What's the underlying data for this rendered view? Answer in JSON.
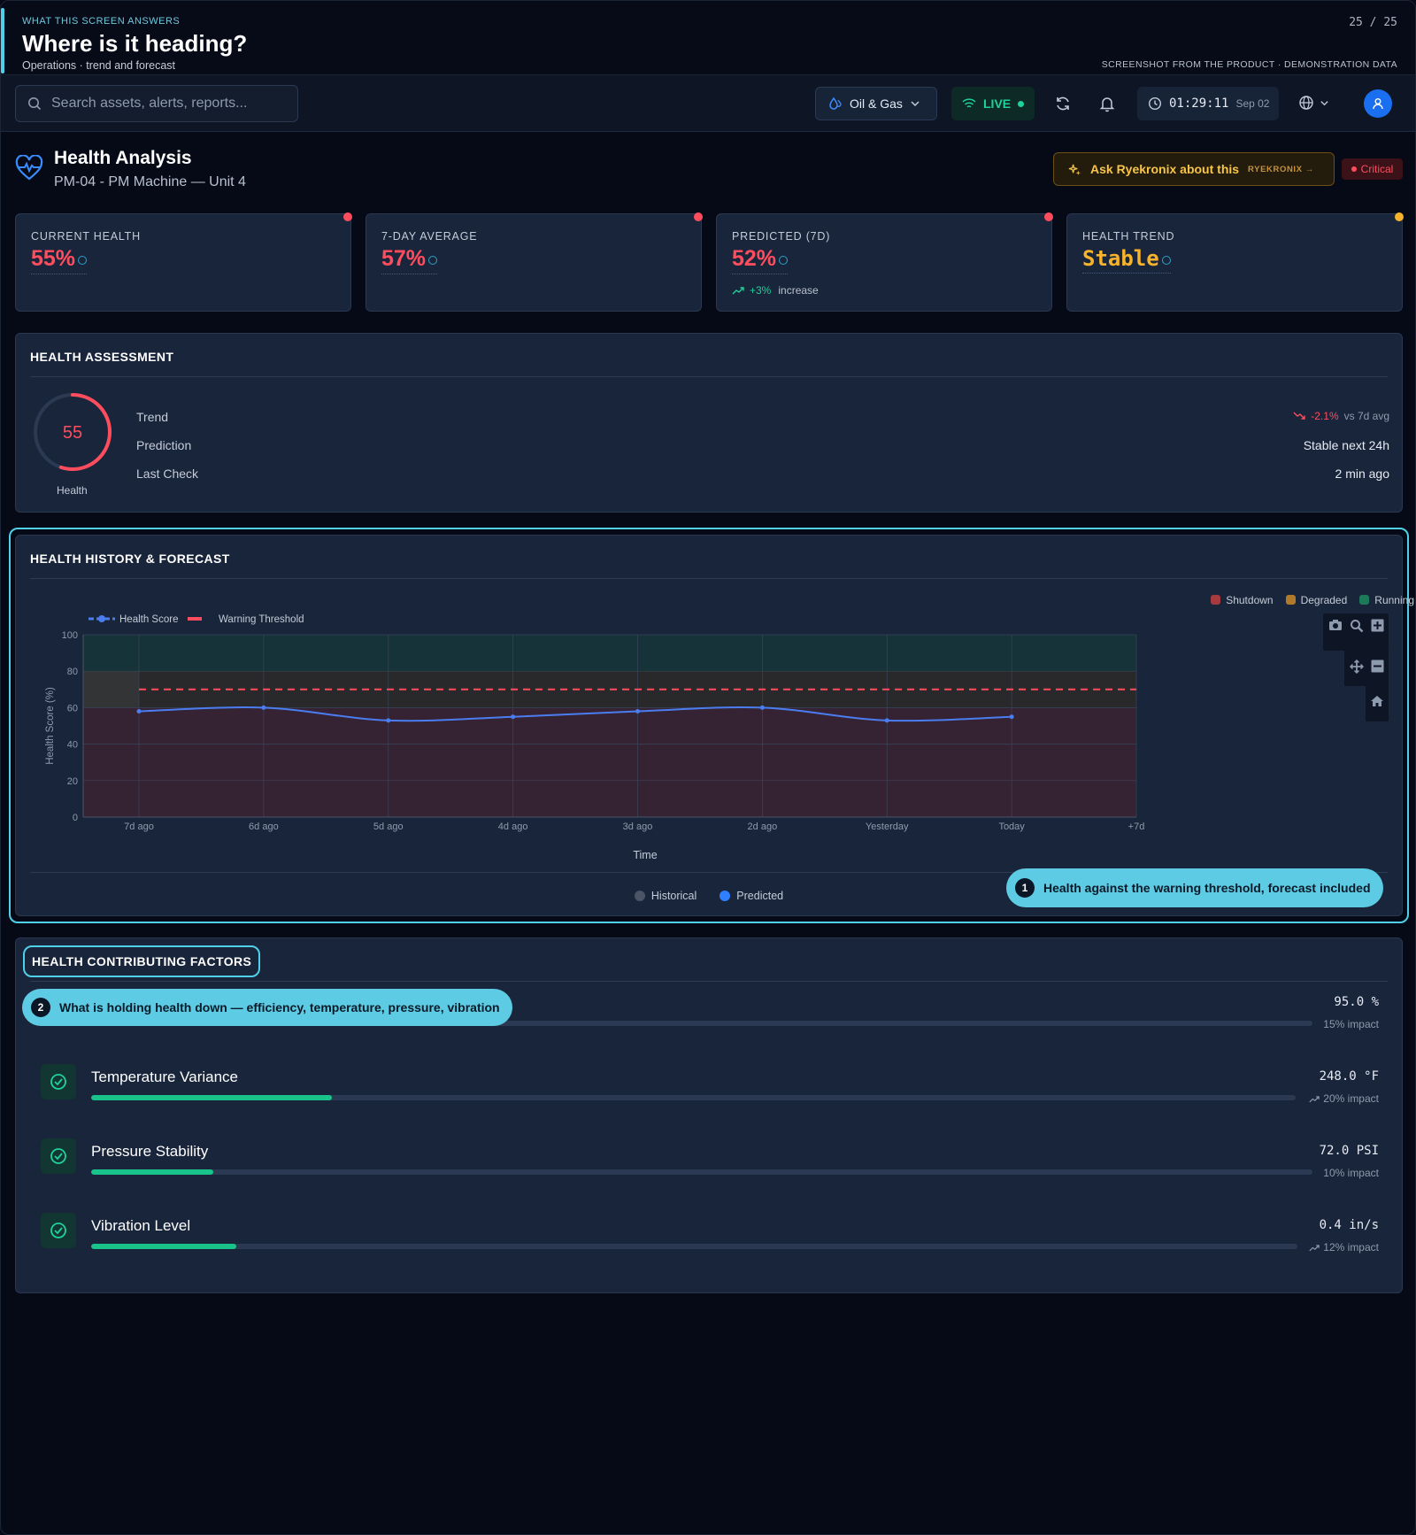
{
  "caption": {
    "eyebrow": "WHAT THIS SCREEN ANSWERS",
    "title": "Where is it heading?",
    "subtitle": "Operations · trend and forecast",
    "page_counter": "25 / 25",
    "note": "SCREENSHOT FROM THE PRODUCT · DEMONSTRATION DATA"
  },
  "toolbar": {
    "search_placeholder": "Search assets, alerts, reports...",
    "industry": "Oil & Gas",
    "live_label": "LIVE",
    "clock_time": "01:29:11",
    "clock_date": "Sep 02"
  },
  "header": {
    "title": "Health Analysis",
    "subtitle": "PM-04 - PM Machine — Unit 4",
    "ask_label": "Ask Ryekronix about this",
    "ask_tag": "RYEKRONIX →",
    "status_badge": "Critical"
  },
  "stats": [
    {
      "label": "CURRENT HEALTH",
      "value": "55%",
      "color": "#ff4d5e"
    },
    {
      "label": "7-DAY AVERAGE",
      "value": "57%",
      "color": "#ff4d5e"
    },
    {
      "label": "PREDICTED (7D)",
      "value": "52%",
      "color": "#ff4d5e",
      "delta": "+3%",
      "delta_text": "increase"
    },
    {
      "label": "HEALTH TREND",
      "value": "Stable",
      "color": "#f7b32b"
    }
  ],
  "assessment": {
    "title": "HEALTH ASSESSMENT",
    "gauge_value": "55",
    "gauge_fraction": 0.55,
    "gauge_label": "Health",
    "rows": [
      {
        "key": "Trend",
        "value": "-2.1%",
        "suffix": "vs 7d avg"
      },
      {
        "key": "Prediction",
        "value": "Stable next 24h"
      },
      {
        "key": "Last Check",
        "value": "2 min ago"
      }
    ]
  },
  "history": {
    "title": "HEALTH HISTORY & FORECAST",
    "status_legend": [
      {
        "label": "Shutdown",
        "color": "#a63a3e"
      },
      {
        "label": "Degraded",
        "color": "#b07a2a"
      },
      {
        "label": "Running",
        "color": "#1c7a5a"
      }
    ],
    "bottom_legend": [
      {
        "label": "Historical",
        "color": "#4b5566"
      },
      {
        "label": "Predicted",
        "color": "#2f7fff"
      }
    ],
    "callout_num": "1",
    "callout_text": "Health against the warning threshold, forecast included"
  },
  "chart_data": {
    "type": "line",
    "x": [
      "7d ago",
      "6d ago",
      "5d ago",
      "4d ago",
      "3d ago",
      "2d ago",
      "Yesterday",
      "Today",
      "+7d"
    ],
    "series": [
      {
        "name": "Health Score",
        "values": [
          58,
          60,
          53,
          55,
          58,
          60,
          53,
          55
        ],
        "color": "#4a7df0"
      },
      {
        "name": "Warning Threshold",
        "values": [
          70,
          70,
          70,
          70,
          70,
          70,
          70,
          70,
          70
        ],
        "color": "#ff4d5e"
      }
    ],
    "xlabel": "Time",
    "ylabel": "Health Score (%)",
    "ylim": [
      0,
      100
    ],
    "yticks": [
      0,
      20,
      40,
      60,
      80,
      100
    ],
    "bands": [
      {
        "from": 0,
        "to": 60,
        "color": "#3a2232"
      },
      {
        "from": 60,
        "to": 80,
        "color": "#2c2a2a"
      },
      {
        "from": 80,
        "to": 100,
        "color": "#14363a"
      }
    ],
    "grid": true,
    "legend": "top-left"
  },
  "factors": {
    "title": "HEALTH CONTRIBUTING FACTORS",
    "callout_num": "2",
    "callout_text": "What is holding health down — efficiency, temperature, pressure, vibration",
    "items": [
      {
        "name": "",
        "value": "95.0 %",
        "impact": "15% impact",
        "fill": 0.15,
        "trend": false
      },
      {
        "name": "Temperature Variance",
        "value": "248.0 °F",
        "impact": "20% impact",
        "fill": 0.2,
        "trend": true
      },
      {
        "name": "Pressure Stability",
        "value": "72.0 PSI",
        "impact": "10% impact",
        "fill": 0.1,
        "trend": false
      },
      {
        "name": "Vibration Level",
        "value": "0.4 in/s",
        "impact": "12% impact",
        "fill": 0.12,
        "trend": true
      }
    ]
  }
}
